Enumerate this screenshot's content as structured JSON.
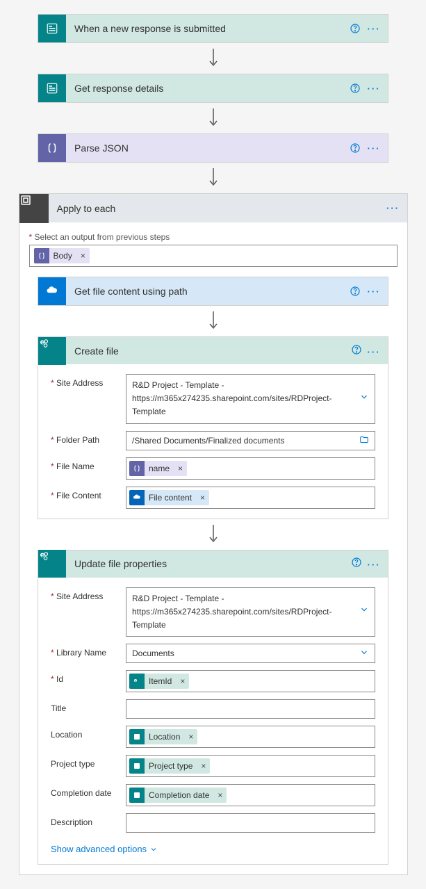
{
  "trigger": {
    "title": "When a new response is submitted"
  },
  "get_response": {
    "title": "Get response details"
  },
  "parse_json": {
    "title": "Parse JSON"
  },
  "apply_to_each": {
    "title": "Apply to each",
    "select_label": "Select an output from previous steps",
    "body_token": "Body"
  },
  "get_file_content": {
    "title": "Get file content using path"
  },
  "create_file": {
    "title": "Create file",
    "fields": {
      "site_address": {
        "label": "Site Address",
        "line1": "R&D Project - Template -",
        "line2": "https://m365x274235.sharepoint.com/sites/RDProject-Template"
      },
      "folder_path": {
        "label": "Folder Path",
        "value": "/Shared Documents/Finalized documents"
      },
      "file_name": {
        "label": "File Name",
        "token": "name"
      },
      "file_content": {
        "label": "File Content",
        "token": "File content"
      }
    }
  },
  "update_props": {
    "title": "Update file properties",
    "fields": {
      "site_address": {
        "label": "Site Address",
        "line1": "R&D Project - Template -",
        "line2": "https://m365x274235.sharepoint.com/sites/RDProject-Template"
      },
      "library_name": {
        "label": "Library Name",
        "value": "Documents"
      },
      "id": {
        "label": "Id",
        "token": "ItemId"
      },
      "title": {
        "label": "Title"
      },
      "location": {
        "label": "Location",
        "token": "Location"
      },
      "project_type": {
        "label": "Project type",
        "token": "Project type"
      },
      "completion_date": {
        "label": "Completion date",
        "token": "Completion date"
      },
      "description": {
        "label": "Description"
      }
    },
    "show_advanced": "Show advanced options"
  }
}
